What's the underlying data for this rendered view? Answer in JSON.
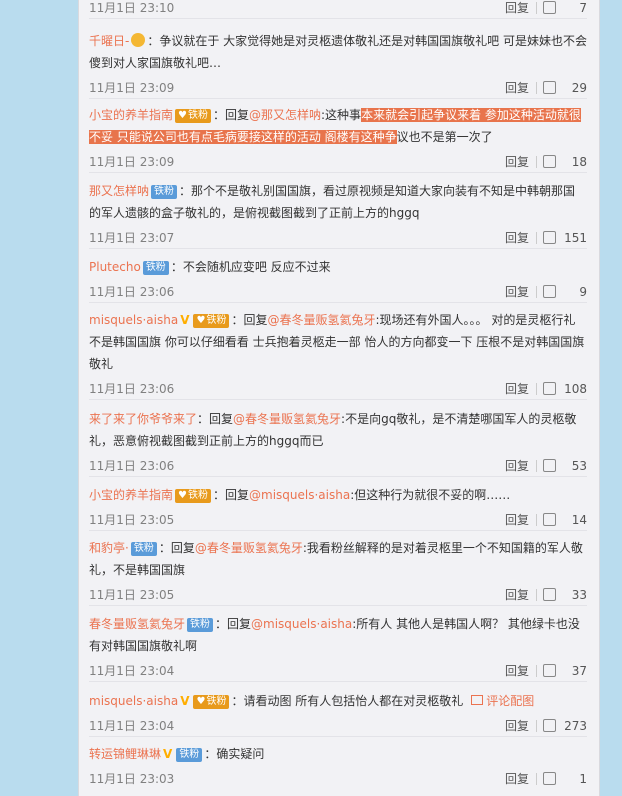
{
  "reply_label": "回复",
  "comments": [
    {
      "time": "11月1日 23:10",
      "likes": "7"
    },
    {
      "user": "千曜日-",
      "text": "：争议就在于 大家觉得她是对灵柩遗体敬礼还是对韩国国旗敬礼吧 可是妹妹也不会傻到对人家国旗敬礼吧…",
      "time": "11月1日 23:09",
      "likes": "29"
    },
    {
      "user": "小宝的养羊指南",
      "badge": "铁粉",
      "prefix": "：回复",
      "at": "@那又怎样呐",
      "text_a": ":这种事",
      "highlight": "本来就会引起争议来着 参加这种活动就很不妥 只能说公司也有点毛病要接这样的活动 阁楼有这种争",
      "text_b": "议也不是第一次了",
      "time": "11月1日 23:09",
      "likes": "18"
    },
    {
      "user": "那又怎样呐",
      "badge": "铁粉",
      "text": "：那个不是敬礼别国国旗，看过原视频是知道大家向装有不知是中韩朝那国的军人遗骸的盒子敬礼的，是俯视截图截到了正前上方的hggq",
      "time": "11月1日 23:07",
      "likes": "151"
    },
    {
      "user": "Plutecho",
      "badge": "铁粉",
      "text": "：不会随机应变吧 反应不过来",
      "time": "11月1日 23:06",
      "likes": "9"
    },
    {
      "user": "misquels·aisha",
      "vip": "V",
      "badge": "铁粉",
      "prefix": "：回复",
      "at": "@春冬量贩氢氦兔牙",
      "text": ":现场还有外国人。。。 对的是灵柩行礼不是韩国国旗 你可以仔细看看 士兵抱着灵柩走一部 怡人的方向都变一下 压根不是对韩国国旗敬礼",
      "time": "11月1日 23:06",
      "likes": "108"
    },
    {
      "user": "来了来了你爷爷来了",
      "prefix": "：回复",
      "at": "@春冬量贩氢氦兔牙",
      "text": ":不是向gq敬礼，是不清楚哪国军人的灵柩敬礼，恶意俯视截图截到正前上方的hggq而已",
      "time": "11月1日 23:06",
      "likes": "53"
    },
    {
      "user": "小宝的养羊指南",
      "badge": "铁粉",
      "prefix": "：回复",
      "at": "@misquels·aisha",
      "text": ":但这种行为就很不妥的啊……",
      "time": "11月1日 23:05",
      "likes": "14"
    },
    {
      "user": "和豹亭·",
      "badge": "铁粉",
      "prefix": "：回复",
      "at": "@春冬量贩氢氦兔牙",
      "text": ":我看粉丝解释的是对着灵柩里一个不知国籍的军人敬礼，不是韩国国旗",
      "time": "11月1日 23:05",
      "likes": "33"
    },
    {
      "user": "春冬量贩氢氦兔牙",
      "badge": "铁粉",
      "prefix": "：回复",
      "at": "@misquels·aisha",
      "text": ":所有人 其他人是韩国人啊？ 其他绿卡也没有对韩国国旗敬礼啊",
      "time": "11月1日 23:04",
      "likes": "37"
    },
    {
      "user": "misquels·aisha",
      "vip": "V",
      "badge": "铁粉",
      "text": "：请看动图 所有人包括怡人都在对灵柩敬礼",
      "pic_label": "评论配图",
      "time": "11月1日 23:04",
      "likes": "273"
    },
    {
      "user": "转运锦鲤琳琳",
      "vip": "V",
      "badge": "铁粉",
      "text": "：确实疑问",
      "time": "11月1日 23:03",
      "likes": "1"
    }
  ]
}
